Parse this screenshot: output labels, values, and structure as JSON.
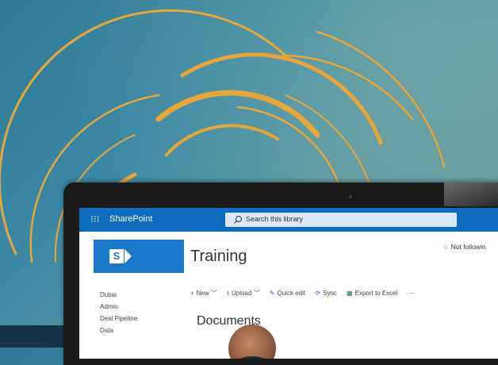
{
  "topbar": {
    "app_name": "SharePoint",
    "search_placeholder": "Search this library"
  },
  "site": {
    "title": "Training",
    "follow_label": "Not followin"
  },
  "nav": {
    "items": [
      "Dubai",
      "Admin",
      "Deal Pipeline",
      "Data"
    ]
  },
  "commands": {
    "new_label": "New",
    "upload_label": "Upload",
    "quick_edit_label": "Quick edit",
    "sync_label": "Sync",
    "export_label": "Export to Excel",
    "more_label": "···"
  },
  "library": {
    "title": "Documents"
  },
  "colors": {
    "accent_orange": "#e8a63a",
    "topbar_blue": "#0f6cbd",
    "logo_blue": "#1979c8"
  }
}
